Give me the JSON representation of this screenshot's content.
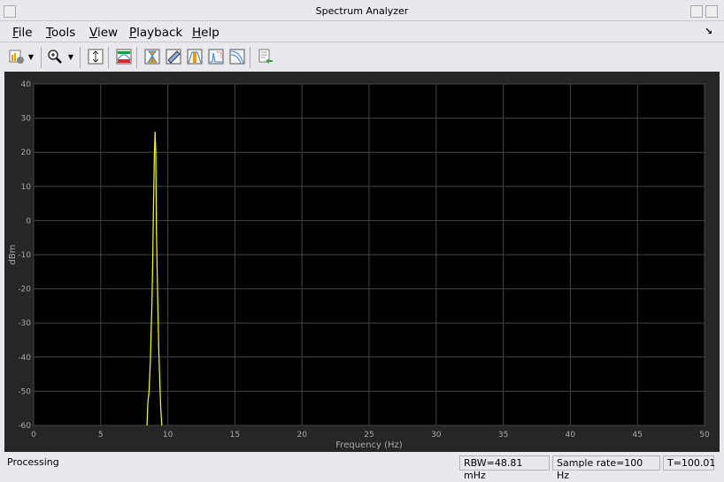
{
  "window": {
    "title": "Spectrum Analyzer"
  },
  "menu": [
    {
      "label": "File",
      "key": "F",
      "rest": "ile"
    },
    {
      "label": "Tools",
      "key": "T",
      "rest": "ools"
    },
    {
      "label": "View",
      "key": "V",
      "rest": "iew"
    },
    {
      "label": "Playback",
      "key": "P",
      "rest": "layback"
    },
    {
      "label": "Help",
      "key": "H",
      "rest": "elp"
    }
  ],
  "toolbar": [
    "spectrum-settings-icon",
    "zoom-in-icon",
    "scale-axes-icon",
    "spectral-mask-icon",
    "data-cursor-icon",
    "measurements-icon",
    "peak-finder-icon",
    "distortion-icon",
    "ccdf-icon",
    "generate-script-icon"
  ],
  "chart_data": {
    "type": "line",
    "xlabel": "Frequency (Hz)",
    "ylabel": "dBm",
    "xlim": [
      0,
      50
    ],
    "ylim": [
      -60,
      40
    ],
    "xticks": [
      "0",
      "5",
      "10",
      "15",
      "20",
      "25",
      "30",
      "35",
      "40",
      "45",
      "50"
    ],
    "yticks": [
      "40",
      "30",
      "20",
      "10",
      "0",
      "-10",
      "-20",
      "-30",
      "-40",
      "-50",
      "-60"
    ],
    "grid": true,
    "color": "#ffff00",
    "x": [
      8.45,
      8.5,
      8.6,
      8.7,
      8.75,
      8.82,
      8.88,
      8.92,
      9.0,
      9.05,
      9.1,
      9.15,
      9.2,
      9.27,
      9.33,
      9.4,
      9.47,
      9.55
    ],
    "y": [
      -60,
      -54,
      -50,
      -41,
      -33,
      -24,
      -11,
      1,
      19,
      26,
      20,
      -2,
      -14,
      -27,
      -38,
      -47,
      -55,
      -60
    ]
  },
  "status": {
    "text": "Processing",
    "rbw": "RBW=48.81 mHz",
    "sample_rate": "Sample rate=100 Hz",
    "time": "T=100.01"
  }
}
